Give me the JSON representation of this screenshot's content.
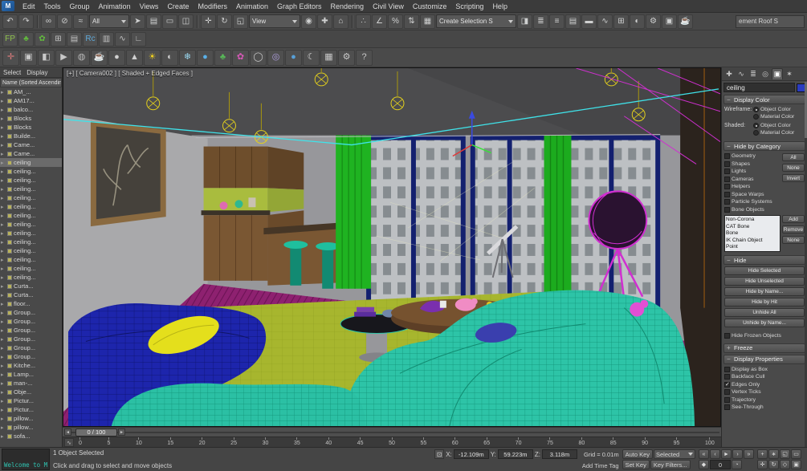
{
  "menu_bar": {
    "logo": "M",
    "items": [
      "Edit",
      "Tools",
      "Group",
      "Animation",
      "Views",
      "Create",
      "Modifiers",
      "Animation",
      "Graph Editors",
      "Rendering",
      "Civil View",
      "Customize",
      "Scripting",
      "Help"
    ]
  },
  "toolbar_main": {
    "history": [
      {
        "name": "undo-icon",
        "glyph": "↶"
      },
      {
        "name": "redo-icon",
        "glyph": "↷"
      }
    ],
    "link": [
      {
        "name": "select-and-link-icon",
        "glyph": "∞"
      },
      {
        "name": "unlink-selection-icon",
        "glyph": "⊘"
      },
      {
        "name": "bind-to-space-warp-icon",
        "glyph": "≈"
      }
    ],
    "selection_filter": "All",
    "select_tools": [
      {
        "name": "select-object-icon",
        "glyph": "➤"
      },
      {
        "name": "select-by-name-icon",
        "glyph": "▤"
      },
      {
        "name": "selection-region-icon",
        "glyph": "▭"
      },
      {
        "name": "window-crossing-icon",
        "glyph": "◫"
      }
    ],
    "transform_tools": [
      {
        "name": "select-and-move-icon",
        "glyph": "✛"
      },
      {
        "name": "select-and-rotate-icon",
        "glyph": "↻"
      },
      {
        "name": "select-and-scale-icon",
        "glyph": "◱"
      }
    ],
    "ref_coord": "View",
    "pivot_tools": [
      {
        "name": "use-pivot-center-icon",
        "glyph": "◉"
      },
      {
        "name": "select-and-manipulate-icon",
        "glyph": "✚"
      },
      {
        "name": "keyboard-override-icon",
        "glyph": "⌂"
      }
    ],
    "snap_tools": [
      {
        "name": "snaps-toggle-icon",
        "glyph": "∴"
      },
      {
        "name": "angle-snap-icon",
        "glyph": "∠"
      },
      {
        "name": "percent-snap-icon",
        "glyph": "%"
      },
      {
        "name": "spinner-snap-icon",
        "glyph": "⇅"
      }
    ],
    "named_tools": [
      {
        "name": "edit-named-selections-icon",
        "glyph": "▦"
      }
    ],
    "named_sets": "Create Selection S",
    "right_tools": [
      {
        "name": "mirror-icon",
        "glyph": "◨"
      },
      {
        "name": "align-icon",
        "glyph": "≣"
      },
      {
        "name": "scene-explorer-icon",
        "glyph": "≡"
      },
      {
        "name": "layer-explorer-icon",
        "glyph": "▤"
      },
      {
        "name": "ribbon-icon",
        "glyph": "▬"
      },
      {
        "name": "curve-editor-icon",
        "glyph": "∿"
      },
      {
        "name": "schematic-view-icon",
        "glyph": "⊞"
      },
      {
        "name": "material-editor-icon",
        "glyph": "◐"
      },
      {
        "name": "render-setup-icon",
        "glyph": "⚙"
      },
      {
        "name": "rendered-frame-icon",
        "glyph": "▣"
      },
      {
        "name": "render-production-icon",
        "glyph": "☕"
      }
    ],
    "workspace_field": "ement Roof S"
  },
  "toolbar_plugins": {
    "icons": [
      {
        "name": "floorgen-icon",
        "glyph": "FP",
        "color": "#8fc24d"
      },
      {
        "name": "forest-pack-icon",
        "glyph": "♣",
        "color": "#62b83e"
      },
      {
        "name": "forest-lister-icon",
        "glyph": "✿",
        "color": "#62b83e"
      },
      {
        "name": "grid-array-icon",
        "glyph": "⊞",
        "color": "#c2c2c2"
      },
      {
        "name": "object-lister-icon",
        "glyph": "▤",
        "color": "#c2c2c2"
      },
      {
        "name": "railclone-icon",
        "glyph": "Rc",
        "color": "#5fa8d8"
      },
      {
        "name": "railclone-lister-icon",
        "glyph": "▥",
        "color": "#c2c2c2"
      },
      {
        "name": "spline-tools-icon",
        "glyph": "∿",
        "color": "#c2c2c2"
      },
      {
        "name": "measure-icon",
        "glyph": "∟",
        "color": "#c2c2c2"
      }
    ]
  },
  "toolbar_render": {
    "icons": [
      {
        "name": "pan-arrows-icon",
        "glyph": "✛",
        "color": "#d87a7a"
      },
      {
        "name": "monitor-icon",
        "glyph": "▣",
        "color": "#c8c8c8"
      },
      {
        "name": "image-editor-icon",
        "glyph": "◧",
        "color": "#c8c8c8"
      },
      {
        "name": "interactive-render-icon",
        "glyph": "▶",
        "color": "#c8c8c8"
      },
      {
        "name": "teapot-gray-icon",
        "glyph": "◍",
        "color": "#b8b8b8"
      },
      {
        "name": "teapot-yellow-icon",
        "glyph": "☕",
        "color": "#e8d51f"
      },
      {
        "name": "sphere-gray-icon",
        "glyph": "●",
        "color": "#d0d0d0"
      },
      {
        "name": "cone-icon",
        "glyph": "▲",
        "color": "#d0d0d0"
      },
      {
        "name": "sun-icon",
        "glyph": "☀",
        "color": "#f0d020"
      },
      {
        "name": "sphere-shaded-icon",
        "glyph": "◐",
        "color": "#d0d0d0"
      },
      {
        "name": "snowflake-icon",
        "glyph": "❄",
        "color": "#9ad8f0"
      },
      {
        "name": "water-drop-icon",
        "glyph": "●",
        "color": "#5ab0e8"
      },
      {
        "name": "leaf-icon",
        "glyph": "♣",
        "color": "#58b858"
      },
      {
        "name": "flower-icon",
        "glyph": "✿",
        "color": "#d858b8"
      },
      {
        "name": "planet-icon",
        "glyph": "◯",
        "color": "#c8c8c8"
      },
      {
        "name": "saturn-icon",
        "glyph": "◎",
        "color": "#b0a0e0"
      },
      {
        "name": "earth-icon",
        "glyph": "●",
        "color": "#58a0d8"
      },
      {
        "name": "moon-icon",
        "glyph": "☾",
        "color": "#d8d8d8"
      },
      {
        "name": "bitmap-icon",
        "glyph": "▦",
        "color": "#c8c8c8"
      },
      {
        "name": "gear-icon",
        "glyph": "⚙",
        "color": "#c8c8c8"
      },
      {
        "name": "help-icon",
        "glyph": "?",
        "color": "#c8c8c8"
      }
    ]
  },
  "scene_explorer": {
    "menus": [
      {
        "label": "Select"
      },
      {
        "label": "Display"
      }
    ],
    "header": "Name (Sorted Ascending)",
    "arrow_glyph": "▸",
    "items": [
      {
        "label": "AM_..."
      },
      {
        "label": "AM17..."
      },
      {
        "label": "balco..."
      },
      {
        "label": "Blocks"
      },
      {
        "label": "Blocks"
      },
      {
        "label": "Builde..."
      },
      {
        "label": "Came..."
      },
      {
        "label": "Came..."
      },
      {
        "label": "ceiling",
        "selected": true
      },
      {
        "label": "ceiling..."
      },
      {
        "label": "ceiling..."
      },
      {
        "label": "ceiling..."
      },
      {
        "label": "ceiling..."
      },
      {
        "label": "ceiling..."
      },
      {
        "label": "ceiling..."
      },
      {
        "label": "ceiling..."
      },
      {
        "label": "ceiling..."
      },
      {
        "label": "ceiling..."
      },
      {
        "label": "ceiling..."
      },
      {
        "label": "ceiling..."
      },
      {
        "label": "ceiling..."
      },
      {
        "label": "ceiling..."
      },
      {
        "label": "Curta..."
      },
      {
        "label": "Curta..."
      },
      {
        "label": "floor..."
      },
      {
        "label": "Group..."
      },
      {
        "label": "Group..."
      },
      {
        "label": "Group..."
      },
      {
        "label": "Group..."
      },
      {
        "label": "Group..."
      },
      {
        "label": "Group..."
      },
      {
        "label": "Kitche..."
      },
      {
        "label": "Lamp..."
      },
      {
        "label": "man-..."
      },
      {
        "label": "Obje..."
      },
      {
        "label": "Pictur..."
      },
      {
        "label": "Pictur..."
      },
      {
        "label": "pillow..."
      },
      {
        "label": "pillow..."
      },
      {
        "label": "sofa..."
      }
    ]
  },
  "viewport": {
    "label": "[+] [ Camera002 ] [ Shaded + Edged Faces ]"
  },
  "command_panel": {
    "tabs": [
      {
        "name": "create-tab-icon",
        "glyph": "✚"
      },
      {
        "name": "modify-tab-icon",
        "glyph": "∿"
      },
      {
        "name": "hierarchy-tab-icon",
        "glyph": "≣"
      },
      {
        "name": "motion-tab-icon",
        "glyph": "◎"
      },
      {
        "name": "display-tab-icon",
        "glyph": "▣",
        "active": true
      },
      {
        "name": "utilities-tab-icon",
        "glyph": "✶"
      }
    ],
    "object_name": "ceiling",
    "display_color": {
      "state_glyph": "−",
      "title": "Display Color",
      "wireframe_label": "Wireframe:",
      "shaded_label": "Shaded:",
      "options": [
        "Object Color",
        "Material Color"
      ],
      "wireframe_object": true,
      "wireframe_material": false,
      "shaded_object": true,
      "shaded_material": false
    },
    "hide_by_category": {
      "state_glyph": "−",
      "title": "Hide by Category",
      "checkboxes": [
        {
          "label": "Geometry",
          "checked": false
        },
        {
          "label": "Shapes",
          "checked": false
        },
        {
          "label": "Lights",
          "checked": false
        },
        {
          "label": "Cameras",
          "checked": false
        },
        {
          "label": "Helpers",
          "checked": false
        },
        {
          "label": "Space Warps",
          "checked": false
        },
        {
          "label": "Particle Systems",
          "checked": false
        },
        {
          "label": "Bone Objects",
          "checked": false
        }
      ],
      "buttons": [
        "All",
        "None",
        "Invert"
      ],
      "list": [
        "Non-Corona",
        "CAT Bone",
        "Bone",
        "IK Chain Object",
        "Point"
      ],
      "list_buttons": [
        "Add",
        "Remove",
        "None"
      ]
    },
    "hide": {
      "state_glyph": "−",
      "title": "Hide",
      "buttons": [
        "Hide Selected",
        "Hide Unselected",
        "Hide by Name...",
        "Hide by Hit",
        "Unhide All",
        "Unhide by Name..."
      ],
      "checkbox": {
        "label": "Hide Frozen Objects",
        "checked": false
      }
    },
    "freeze": {
      "state_glyph": "+",
      "title": "Freeze"
    },
    "display_properties": {
      "state_glyph": "−",
      "title": "Display Properties",
      "checkboxes": [
        {
          "label": "Display as Box",
          "checked": false
        },
        {
          "label": "Backface Cull",
          "checked": false
        },
        {
          "label": "Edges Only",
          "checked": true
        },
        {
          "label": "Vertex Ticks",
          "checked": false
        },
        {
          "label": "Trajectory",
          "checked": false
        },
        {
          "label": "See-Through",
          "checked": false
        }
      ]
    }
  },
  "timeline": {
    "prev_glyph": "◄",
    "next_glyph": "►",
    "curve_toggle_glyph": "∿",
    "slider": "0 / 100",
    "ticks": [
      "0",
      "5",
      "10",
      "15",
      "20",
      "25",
      "30",
      "35",
      "40",
      "45",
      "50",
      "55",
      "60",
      "65",
      "70",
      "75",
      "80",
      "85",
      "90",
      "95",
      "100"
    ]
  },
  "status_bar": {
    "listener": "Welcome to M",
    "selection_status": "1 Object Selected",
    "prompt": "Click and drag to select and move objects",
    "lock_glyph": "⊡",
    "coords": {
      "x_label": "X:",
      "x": "-12.109m",
      "y_label": "Y:",
      "y": "59.223m",
      "z_label": "Z:",
      "z": "3.118m"
    },
    "grid": "Grid = 0.01m",
    "add_time_tag": "Add Time Tag",
    "auto_key": "Auto Key",
    "set_key": "Set Key",
    "key_filters": "Key Filters...",
    "selected_dropdown": "Selected",
    "playback_row1": [
      {
        "name": "go-to-start-icon",
        "glyph": "«"
      },
      {
        "name": "previous-frame-icon",
        "glyph": "‹"
      },
      {
        "name": "play-animation-icon",
        "glyph": "►"
      },
      {
        "name": "next-frame-icon",
        "glyph": "›"
      },
      {
        "name": "go-to-end-icon",
        "glyph": "»"
      }
    ],
    "key_mode_glyph": "◆",
    "frame": "0",
    "time_config_glyph": "◔",
    "viewnav": [
      {
        "name": "zoom-icon",
        "glyph": "+"
      },
      {
        "name": "zoom-all-icon",
        "glyph": "∗"
      },
      {
        "name": "zoom-extents-icon",
        "glyph": "◱"
      },
      {
        "name": "zoom-region-icon",
        "glyph": "▭"
      },
      {
        "name": "pan-icon",
        "glyph": "✛"
      },
      {
        "name": "orbit-icon",
        "glyph": "↻"
      },
      {
        "name": "fov-icon",
        "glyph": "◇"
      },
      {
        "name": "maximize-viewport-icon",
        "glyph": "▣"
      }
    ]
  },
  "scene_colors": {
    "carpet_magenta": "#8e2170",
    "rug_green": "#a7b62e",
    "sofa_navy": "#1d25ac",
    "sofa_teal": "#2dc4a7",
    "curtain_green": "#1fb321",
    "lamp_magenta": "#d02fd0",
    "light_yellow": "#e2cf1d",
    "window_frame_navy": "#13206f",
    "selection_cyan": "#3fe3ea"
  }
}
